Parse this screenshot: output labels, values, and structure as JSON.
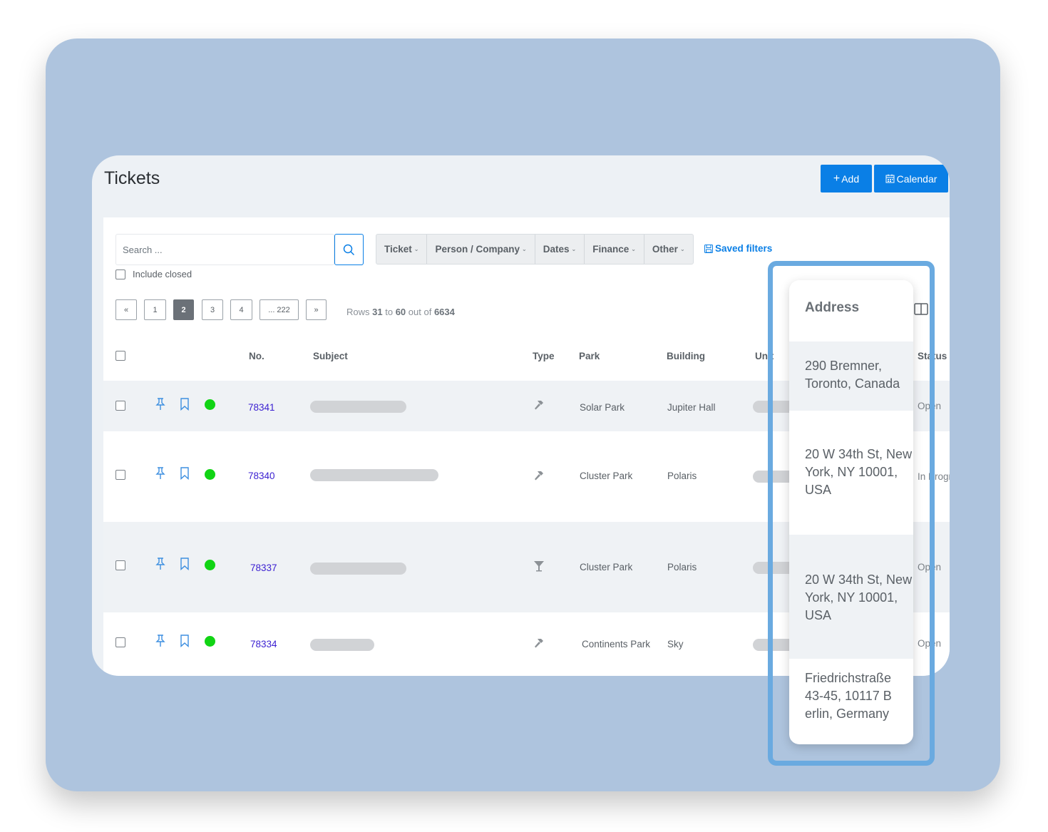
{
  "header": {
    "title": "Tickets",
    "add_label": "Add",
    "calendar_label": "Calendar"
  },
  "search": {
    "placeholder": "Search ...",
    "include_closed_label": "Include closed"
  },
  "filters": [
    "Ticket",
    "Person / Company",
    "Dates",
    "Finance",
    "Other"
  ],
  "saved_filters_label": "Saved filters",
  "pagination": {
    "prev": "«",
    "pages": [
      "1",
      "2",
      "3",
      "4",
      "... 222"
    ],
    "active_page": "2",
    "next": "»"
  },
  "rows_info": {
    "prefix": "Rows",
    "from": "31",
    "mid": "to",
    "to": "60",
    "mid2": "out of",
    "total": "6634"
  },
  "columns": {
    "no": "No.",
    "subject": "Subject",
    "type": "Type",
    "park": "Park",
    "building": "Building",
    "unit": "Unit",
    "status": "Status"
  },
  "rows": [
    {
      "no": "78341",
      "type_icon": "hammer-icon",
      "park": "Solar Park",
      "building": "Jupiter Hall",
      "status": "Open"
    },
    {
      "no": "78340",
      "type_icon": "hammer-icon",
      "park": "Cluster Park",
      "building": "Polaris",
      "status": "In Progress"
    },
    {
      "no": "78337",
      "type_icon": "cocktail-icon",
      "park": "Cluster Park",
      "building": "Polaris",
      "status": "Open"
    },
    {
      "no": "78334",
      "type_icon": "hammer-icon",
      "park": "Continents Park",
      "building": "Sky",
      "status": "Open"
    }
  ],
  "address_popup": {
    "heading": "Address",
    "items": [
      " 290 Bremner, Toronto, Canada",
      "20 W 34th St, New York, NY 10001, USA",
      "20 W 34th St, New York, NY 10001, USA",
      "Friedrichstraße 43-45, 10117 Berlin, Germany"
    ]
  },
  "colors": {
    "primary": "#0a7fe6",
    "status_dot": "#11d414",
    "ticket_link": "#3a1fd1",
    "highlight_border": "#6aaae0",
    "backdrop": "#aec4de"
  }
}
